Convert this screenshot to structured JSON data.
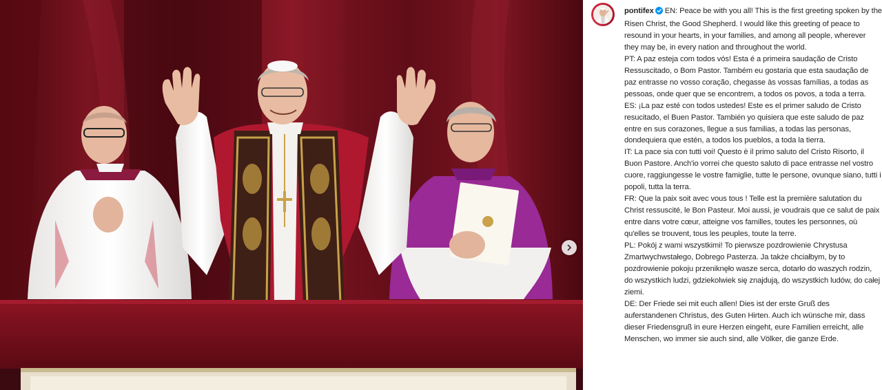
{
  "post": {
    "username": "pontifex",
    "verified": true,
    "accent_color": "#0095f6",
    "icons": {
      "avatar": "profile-avatar",
      "verified": "verified-badge-icon",
      "next": "chevron-right-icon"
    },
    "caption": [
      "EN: Peace be with you all! This is the first greeting spoken by the Risen Christ, the Good Shepherd. I would like this greeting of peace to resound in your hearts, in your families, and among all people, wherever they may be, in every nation and throughout the world.",
      "PT: A paz esteja com todos vós! Esta é a primeira saudação de Cristo Ressuscitado, o Bom Pastor. Também eu gostaria que esta saudação de paz entrasse no vosso coração, chegasse às vossas famílias, a todas as pessoas, onde quer que se encontrem, a todos os povos, a toda a terra.",
      "ES: ¡La paz esté con todos ustedes! Este es el primer saludo de Cristo resucitado, el Buen Pastor. También yo quisiera que este saludo de paz entre en sus corazones, llegue a sus familias, a todas las personas, dondequiera que estén, a todos los pueblos, a toda la tierra.",
      "IT: La pace sia con tutti voi! Questo è il primo saluto del Cristo Risorto, il Buon Pastore. Anch'io vorrei che questo saluto di pace entrasse nel vostro cuore, raggiungesse le vostre famiglie, tutte le persone, ovunque siano, tutti i popoli, tutta la terra.",
      "FR: Que la paix soit avec vous tous ! Telle est la première salutation du Christ ressuscité, le Bon Pasteur. Moi aussi, je voudrais que ce salut de paix entre dans votre cœur, atteigne vos familles, toutes les personnes, où qu'elles se trouvent, tous les peuples, toute la terre.",
      "PL: Pokój z wami wszystkimi! To pierwsze pozdrowienie Chrystusa Zmartwychwstałego, Dobrego Pasterza. Ja także chciałbym, by to pozdrowienie pokoju przeniknęło wasze serca, dotarło do waszych rodzin, do wszystkich ludzi, gdziekolwiek się znajdują, do wszystkich ludów, do całej ziemi.",
      "DE: Der Friede sei mit euch allen! Dies ist der erste Gruß des auferstandenen Christus, des Guten Hirten. Auch ich wünsche mir, dass dieser Friedensgruß in eure Herzen eingeht, eure Familien erreicht, alle Menschen, wo immer sie auch sind, alle Völker, die ganze Erde."
    ]
  }
}
